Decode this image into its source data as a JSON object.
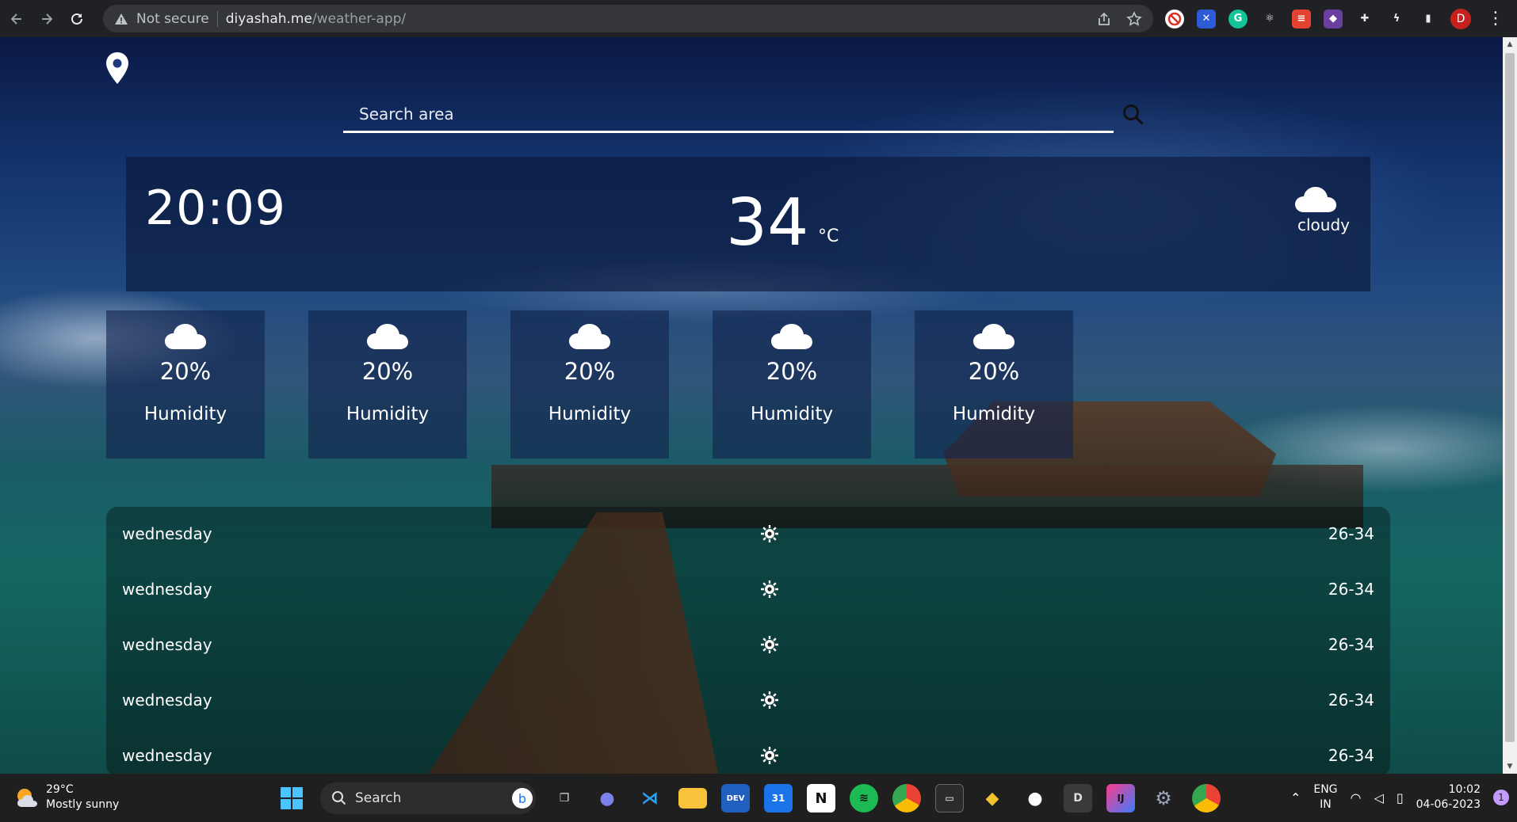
{
  "browser": {
    "security_label": "Not secure",
    "url_domain": "diyashah.me",
    "url_path": "/weather-app/",
    "avatar_letter": "D"
  },
  "app": {
    "search": {
      "placeholder": "Search area"
    },
    "current": {
      "time": "20:09",
      "temperature": "34",
      "unit": "°C",
      "condition": "cloudy",
      "condition_icon": "cloud-icon"
    },
    "humidity_cards": [
      {
        "value": "20%",
        "label": "Humidity",
        "icon": "cloud-icon"
      },
      {
        "value": "20%",
        "label": "Humidity",
        "icon": "cloud-icon"
      },
      {
        "value": "20%",
        "label": "Humidity",
        "icon": "cloud-icon"
      },
      {
        "value": "20%",
        "label": "Humidity",
        "icon": "cloud-icon"
      },
      {
        "value": "20%",
        "label": "Humidity",
        "icon": "cloud-icon"
      }
    ],
    "forecast": [
      {
        "day": "wednesday",
        "icon": "sun-icon",
        "range": "26-34"
      },
      {
        "day": "wednesday",
        "icon": "sun-icon",
        "range": "26-34"
      },
      {
        "day": "wednesday",
        "icon": "sun-icon",
        "range": "26-34"
      },
      {
        "day": "wednesday",
        "icon": "sun-icon",
        "range": "26-34"
      },
      {
        "day": "wednesday",
        "icon": "sun-icon",
        "range": "26-34"
      }
    ]
  },
  "taskbar": {
    "weather_temp": "29°C",
    "weather_desc": "Mostly sunny",
    "search_label": "Search",
    "lang_line1": "ENG",
    "lang_line2": "IN",
    "clock_time": "10:02",
    "clock_date": "04-06-2023",
    "notification_count": "1"
  },
  "colors": {
    "chrome_bg": "#202124",
    "omnibox_bg": "#35363a",
    "card_bg": "#12244e",
    "taskbar_bg": "#1f1f1f"
  }
}
